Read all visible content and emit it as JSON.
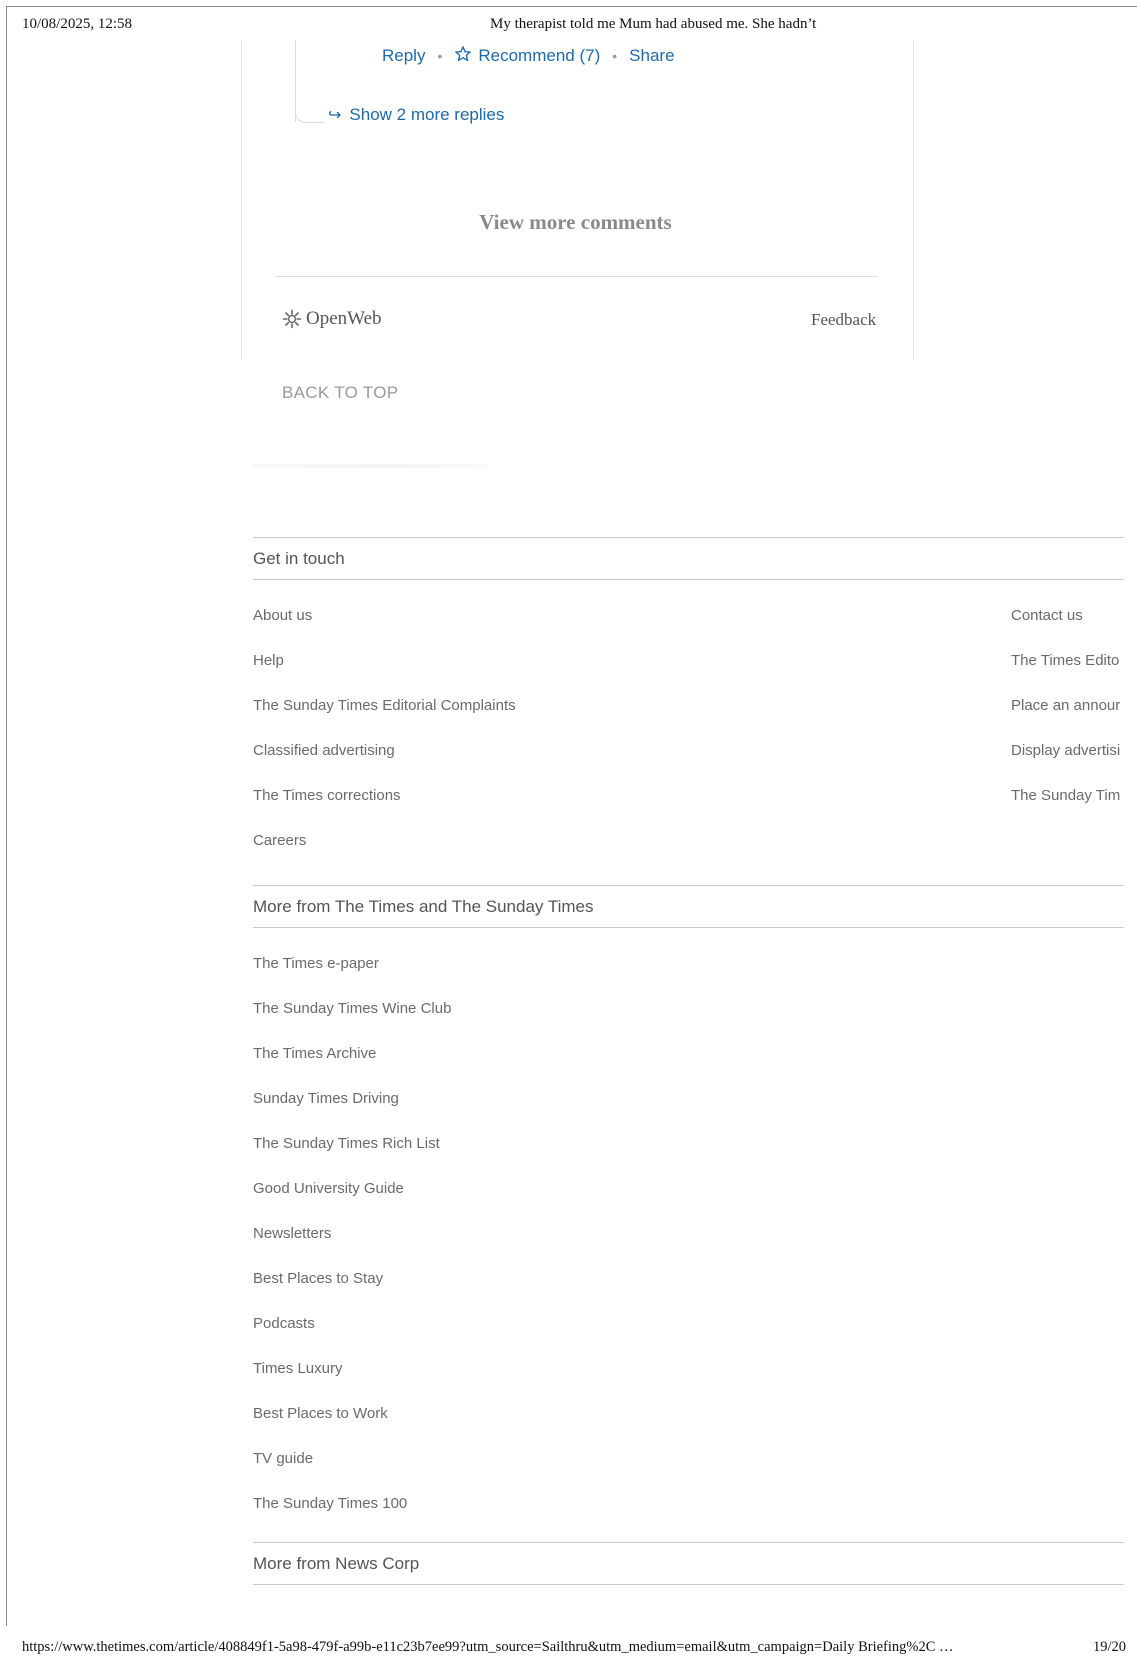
{
  "print_header": {
    "datetime": "10/08/2025, 12:58",
    "title": "My therapist told me Mum had abused me. She hadn’t"
  },
  "print_footer": {
    "url": "https://www.thetimes.com/article/408849f1-5a98-479f-a99b-e11c23b7ee99?utm_source=Sailthru&utm_medium=email&utm_campaign=Daily Briefing%2C …",
    "page": "19/20"
  },
  "comment_actions": {
    "reply": "Reply",
    "recommend": "Recommend (7)",
    "share": "Share",
    "dot": "•"
  },
  "show_replies": "Show 2 more replies",
  "view_more": "View more comments",
  "openweb": {
    "brand": "OpenWeb",
    "feedback": "Feedback"
  },
  "back_to_top": "BACK TO TOP",
  "footer": {
    "get_in_touch": {
      "title": "Get in touch",
      "left_links": [
        "About us",
        "Help",
        "The Sunday Times Editorial Complaints",
        "Classified advertising",
        "The Times corrections",
        "Careers"
      ],
      "right_links": [
        "Contact us",
        "The Times Edito",
        "Place an annour",
        "Display advertisi",
        "The Sunday Tim"
      ]
    },
    "more_from_times": {
      "title": "More from The Times and The Sunday Times",
      "links": [
        "The Times e-paper",
        "The Sunday Times Wine Club",
        "The Times Archive",
        "Sunday Times Driving",
        "The Sunday Times Rich List",
        "Good University Guide",
        "Newsletters",
        "Best Places to Stay",
        "Podcasts",
        "Times Luxury",
        "Best Places to Work",
        "TV guide",
        "The Sunday Times 100"
      ]
    },
    "more_from_news_corp": {
      "title": "More from News Corp"
    }
  },
  "colors": {
    "link_blue": "#1f6aa5",
    "footer_text": "#6a6a6a"
  }
}
